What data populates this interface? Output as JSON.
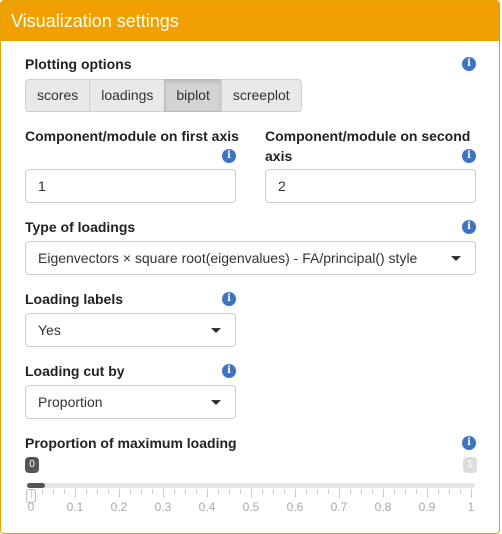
{
  "panel": {
    "title": "Visualization settings"
  },
  "plotting": {
    "label": "Plotting options",
    "buttons": [
      "scores",
      "loadings",
      "biplot",
      "screeplot"
    ],
    "active": "biplot"
  },
  "axes": {
    "first_label": "Component/module on first axis",
    "first_value": "1",
    "second_label_line1": "Component/module on second",
    "second_label_line2": "axis",
    "second_value": "2"
  },
  "loadings_type": {
    "label": "Type of loadings",
    "value": "Eigenvectors × square root(eigenvalues) - FA/principal() style"
  },
  "loading_labels": {
    "label": "Loading labels",
    "value": "Yes"
  },
  "loading_cut": {
    "label": "Loading cut by",
    "value": "Proportion"
  },
  "proportion": {
    "label": "Proportion of maximum loading",
    "min_value": "0",
    "max_value": "1",
    "current": 0,
    "ticks": [
      "0",
      "0.1",
      "0.2",
      "0.3",
      "0.4",
      "0.5",
      "0.6",
      "0.7",
      "0.8",
      "0.9",
      "1"
    ]
  },
  "icons": {
    "info": "info-icon",
    "dropdown": "caret-down-icon"
  },
  "colors": {
    "header": "#f0a000",
    "info": "#3c73c7"
  }
}
